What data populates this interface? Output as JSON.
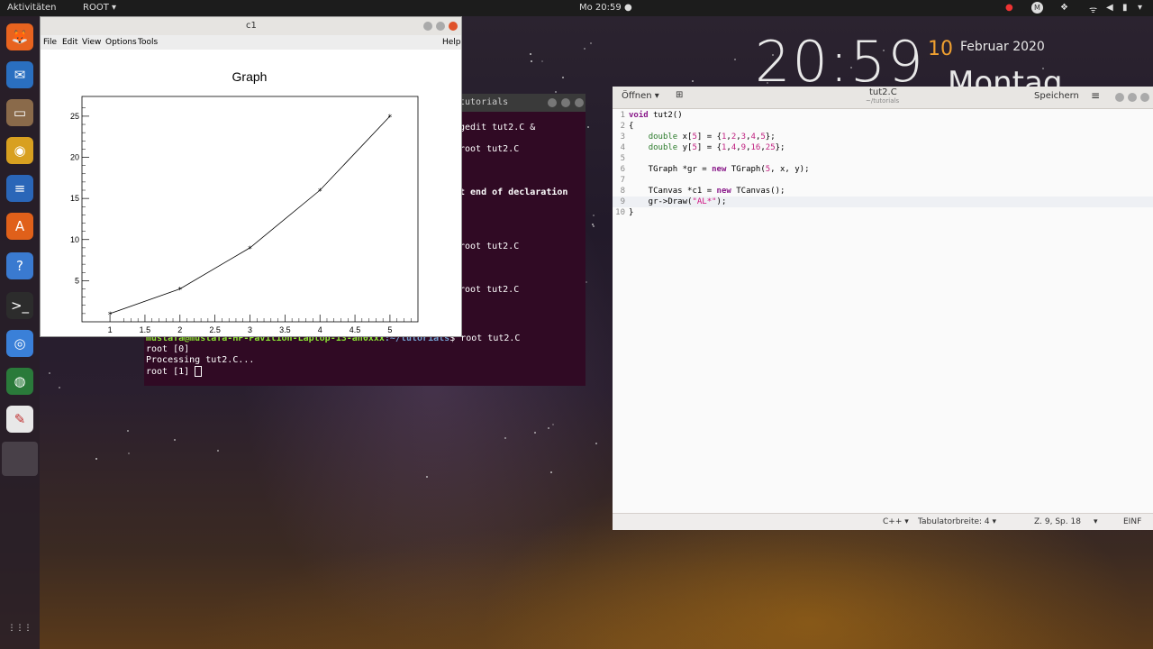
{
  "topbar": {
    "activities": "Aktivitäten",
    "app": "ROOT",
    "time": "Mo 20:59"
  },
  "desktop_clock": {
    "time": "20:59",
    "day": "10",
    "month_year": "Februar 2020",
    "weekday": "Montag"
  },
  "dock": [
    {
      "name": "firefox-icon",
      "glyph": "🦊",
      "color": "#e8631f"
    },
    {
      "name": "thunderbird-icon",
      "glyph": "✉",
      "color": "#2a6fc0"
    },
    {
      "name": "files-icon",
      "glyph": "▭",
      "color": "#8a6a4a"
    },
    {
      "name": "rhythmbox-icon",
      "glyph": "◉",
      "color": "#d8a020"
    },
    {
      "name": "writer-icon",
      "glyph": "≡",
      "color": "#2a66b8"
    },
    {
      "name": "software-icon",
      "glyph": "A",
      "color": "#e0601a"
    },
    {
      "name": "help-icon",
      "glyph": "?",
      "color": "#3a7ad0"
    },
    {
      "name": "terminal-icon",
      "glyph": ">_",
      "color": "#2c2c2c"
    },
    {
      "name": "chromium-icon",
      "glyph": "◎",
      "color": "#3a80d8"
    },
    {
      "name": "globe-icon",
      "glyph": "◍",
      "color": "#2a7a3a"
    },
    {
      "name": "text-editor-icon",
      "glyph": "✎",
      "color": "#e8e8e8"
    },
    {
      "name": "show-apps-icon",
      "glyph": "⋮⋮⋮",
      "color": "transparent"
    }
  ],
  "canvas": {
    "title": "c1",
    "menu": [
      "File",
      "Edit",
      "View",
      "Options",
      "Tools"
    ],
    "help": "Help"
  },
  "chart_data": {
    "type": "line",
    "title": "Graph",
    "x": [
      1,
      2,
      3,
      4,
      5
    ],
    "y": [
      1,
      4,
      9,
      16,
      25
    ],
    "xlim": [
      0.6,
      5.4
    ],
    "ylim": [
      0,
      27.4
    ],
    "xticks": [
      "1",
      "1.5",
      "2",
      "2.5",
      "3",
      "3.5",
      "4",
      "4.5",
      "5"
    ],
    "yticks": [
      "5",
      "10",
      "15",
      "20",
      "25"
    ],
    "marker": "*",
    "grid": false
  },
  "terminal": {
    "title": "tutorials",
    "lines": [
      {
        "text": "gedit tut2.C &",
        "top": 38
      },
      {
        "text": "root tut2.C",
        "top": 62
      },
      {
        "text": "t end of declaration",
        "top": 110,
        "bold": true
      },
      {
        "text": "root tut2.C",
        "top": 170
      },
      {
        "text": "root tut2.C",
        "top": 218
      }
    ],
    "prompt_user": "mustafa@mustafa-HP-Pavilion-Laptop-13-an0xxx",
    "prompt_path": ":~/tutorials",
    "prompt_cmd": "$ root tut2.C",
    "out1": "root [0]",
    "out2": "Processing tut2.C...",
    "out3": "root [1] "
  },
  "gedit": {
    "open_label": "Öffnen",
    "title": "tut2.C",
    "subtitle": "~/tutorials",
    "save_label": "Speichern",
    "status_lang": "C++",
    "status_tab": "Tabulatorbreite: 4",
    "status_pos": "Z. 9, Sp. 18",
    "status_mode": "EINF"
  }
}
